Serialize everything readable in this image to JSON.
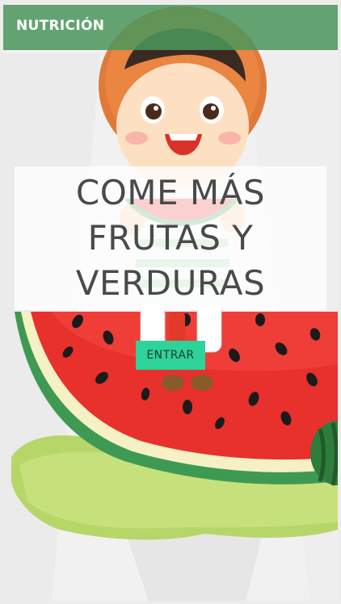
{
  "header": {
    "brand": "NUTRICIÓN"
  },
  "hero": {
    "title_lines": [
      "COME MÁS",
      "FRUTAS Y",
      "VERDURAS"
    ],
    "cta_label": "ENTRAR"
  },
  "colors": {
    "header_bg": "#4c965c",
    "cta_bg": "#2ed39a",
    "title_text": "#4a4a4a",
    "watermelon_flesh": "#e8302c",
    "watermelon_rind": "#3e9a52",
    "grass": "#b6d66a"
  },
  "illustration": {
    "subject": "cartoon-child-eating-watermelon"
  }
}
